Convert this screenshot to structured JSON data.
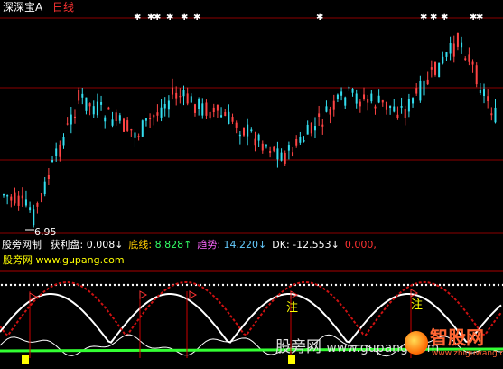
{
  "header": {
    "symbol": "深深宝A",
    "period": "日线",
    "low_price": "6.95"
  },
  "indicator": {
    "site_name": "股旁网制",
    "items": [
      {
        "label": "获利盘: ",
        "value": "0.008",
        "arrow": "↓",
        "label_color": "#ffffff",
        "value_color": "#ffffff",
        "arrow_color": "#ffffff"
      },
      {
        "label": "底线: ",
        "value": "8.828",
        "arrow": "↑",
        "label_color": "#ffcc00",
        "value_color": "#33ff66",
        "arrow_color": "#33ff66"
      },
      {
        "label": "趋势: ",
        "value": "14.220",
        "arrow": "↓",
        "label_color": "#ff66ff",
        "value_color": "#66ccff",
        "arrow_color": "#66ccff"
      },
      {
        "label": "DK: ",
        "value": "-12.553",
        "arrow": "↓",
        "label_color": "#ffffff",
        "value_color": "#ffffff",
        "arrow_color": "#ffffff"
      },
      {
        "label": "",
        "value": "0.000",
        "arrow": ",",
        "label_color": "#ff3333",
        "value_color": "#ff3333",
        "arrow_color": "#ff3333"
      }
    ],
    "watermark_small": "股旁网 www.gupang.com",
    "markers": [
      "注",
      "注"
    ]
  },
  "watermark": {
    "text_left": "股旁网",
    "url": "www.gupang.com",
    "brand": "智股网",
    "brand_url": "www.zhiguwang.cn"
  },
  "colors": {
    "up": "#ff4444",
    "down": "#33ddee",
    "grid": "#8b0000",
    "green_line": "#33ff33",
    "yellow": "#ffff00"
  }
}
